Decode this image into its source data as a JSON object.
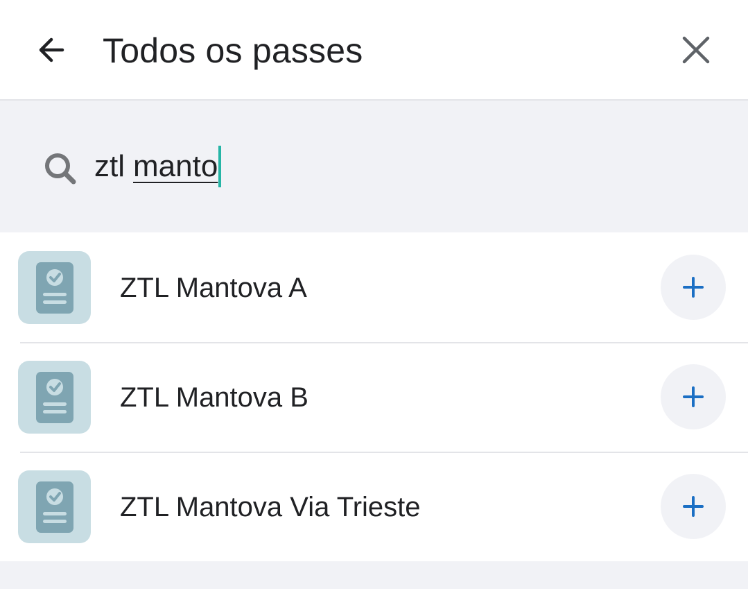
{
  "header": {
    "title": "Todos os passes",
    "back_icon": "arrow-left-icon",
    "close_icon": "close-icon"
  },
  "search": {
    "value_word1": "ztl",
    "value_word2": "manto",
    "icon": "search-icon"
  },
  "results": [
    {
      "label": "ZTL Mantova A",
      "icon": "pass-document-icon",
      "action_icon": "plus-icon"
    },
    {
      "label": "ZTL Mantova B",
      "icon": "pass-document-icon",
      "action_icon": "plus-icon"
    },
    {
      "label": "ZTL Mantova Via Trieste",
      "icon": "pass-document-icon",
      "action_icon": "plus-icon"
    }
  ],
  "colors": {
    "accent": "#1b6fc4",
    "caret": "#26b5a6",
    "icon_tile": "#c8dde3",
    "icon_fg": "#7fa5b2",
    "background": "#f1f2f6"
  }
}
